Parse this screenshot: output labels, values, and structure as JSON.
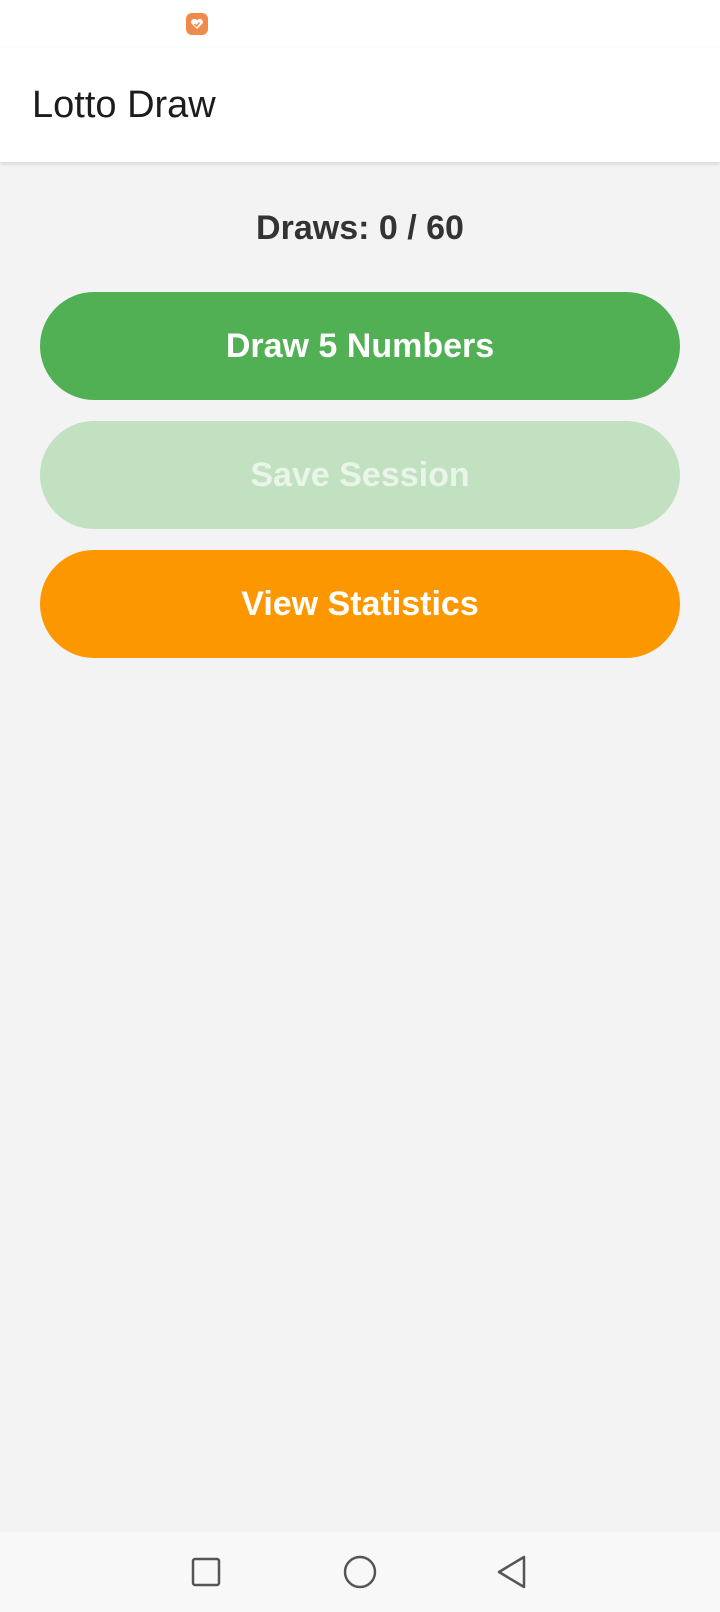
{
  "app_bar": {
    "title": "Lotto Draw"
  },
  "main": {
    "draws_counter": "Draws: 0 / 60",
    "buttons": {
      "draw": {
        "label": "Draw 5 Numbers",
        "color": "#52b054",
        "enabled": true
      },
      "save": {
        "label": "Save Session",
        "color": "#c1e1c1",
        "enabled": false
      },
      "stats": {
        "label": "View Statistics",
        "color": "#fd9700",
        "enabled": true
      }
    }
  },
  "status_bar": {
    "icons": [
      "app-notification-icon"
    ]
  },
  "nav_bar": {
    "icons": [
      "recents-icon",
      "home-icon",
      "back-icon"
    ]
  }
}
